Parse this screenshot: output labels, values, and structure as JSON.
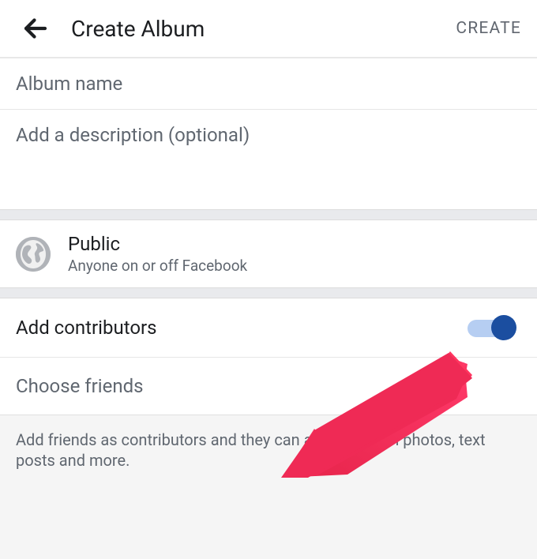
{
  "header": {
    "title": "Create Album",
    "create_label": "CREATE"
  },
  "fields": {
    "name_placeholder": "Album name",
    "desc_placeholder": "Add a description (optional)"
  },
  "privacy": {
    "title": "Public",
    "subtitle": "Anyone on or off Facebook"
  },
  "contributors": {
    "label": "Add contributors",
    "toggle_on": true,
    "choose_label": "Choose friends",
    "help_text": "Add friends as contributors and they can add their own photos, text posts and more."
  }
}
